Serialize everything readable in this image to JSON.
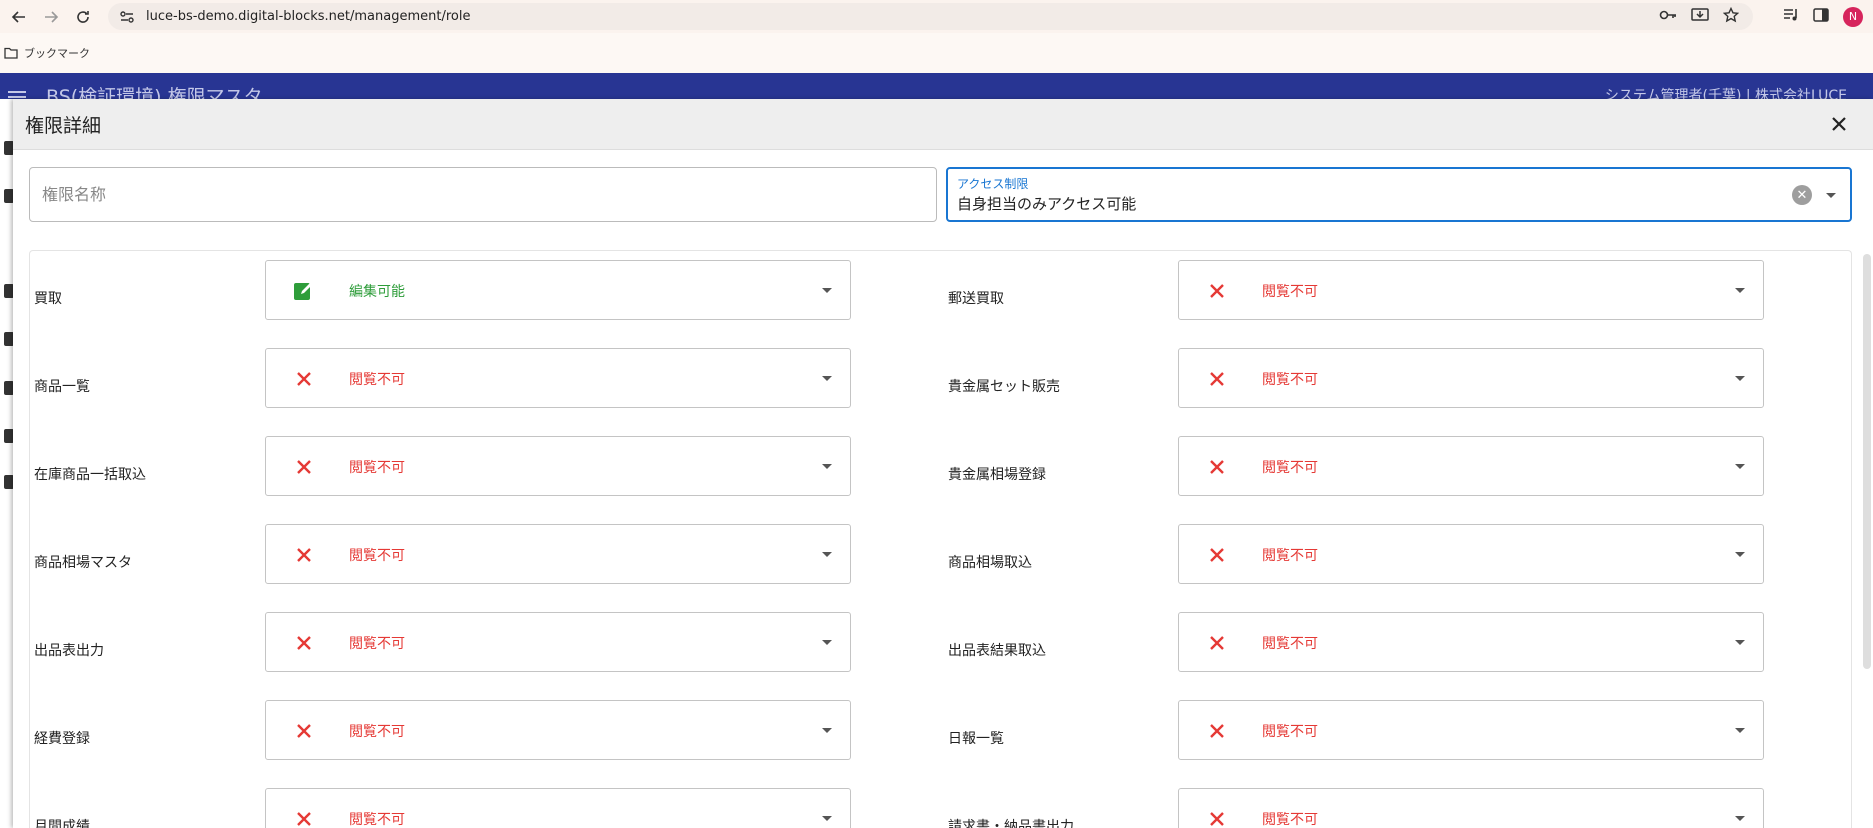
{
  "browser": {
    "url": "luce-bs-demo.digital-blocks.net/management/role",
    "bookmark_label": "ブックマーク",
    "profile_initial": "N"
  },
  "app": {
    "title": "BS(検証環境) 権限マスタ",
    "user": "システム管理者(千葉) | 株式会社LUCE"
  },
  "dialog": {
    "title": "権限詳細",
    "name_field_placeholder": "権限名称",
    "name_field_value": "",
    "access_label": "アクセス制限",
    "access_value": "自身担当のみアクセス可能"
  },
  "permissions": [
    {
      "left_label": "買取",
      "left_value": "編集可能",
      "left_kind": "edit",
      "right_label": "郵送買取",
      "right_value": "閲覧不可",
      "right_kind": "deny"
    },
    {
      "left_label": "商品一覧",
      "left_value": "閲覧不可",
      "left_kind": "deny",
      "right_label": "貴金属セット販売",
      "right_value": "閲覧不可",
      "right_kind": "deny"
    },
    {
      "left_label": "在庫商品一括取込",
      "left_value": "閲覧不可",
      "left_kind": "deny",
      "right_label": "貴金属相場登録",
      "right_value": "閲覧不可",
      "right_kind": "deny"
    },
    {
      "left_label": "商品相場マスタ",
      "left_value": "閲覧不可",
      "left_kind": "deny",
      "right_label": "商品相場取込",
      "right_value": "閲覧不可",
      "right_kind": "deny"
    },
    {
      "left_label": "出品表出力",
      "left_value": "閲覧不可",
      "left_kind": "deny",
      "right_label": "出品表結果取込",
      "right_value": "閲覧不可",
      "right_kind": "deny"
    },
    {
      "left_label": "経費登録",
      "left_value": "閲覧不可",
      "left_kind": "deny",
      "right_label": "日報一覧",
      "right_value": "閲覧不可",
      "right_kind": "deny"
    },
    {
      "left_label": "月間成績",
      "left_value": "閲覧不可",
      "left_kind": "deny",
      "right_label": "請求書・納品書出力",
      "right_value": "閲覧不可",
      "right_kind": "deny"
    }
  ],
  "colors": {
    "primary": "#1976d2",
    "header_bg": "#283593",
    "edit": "#2e9d3a",
    "deny": "#e53935"
  },
  "icons": {
    "edit": "edit-note-icon",
    "deny": "close-x-icon"
  }
}
